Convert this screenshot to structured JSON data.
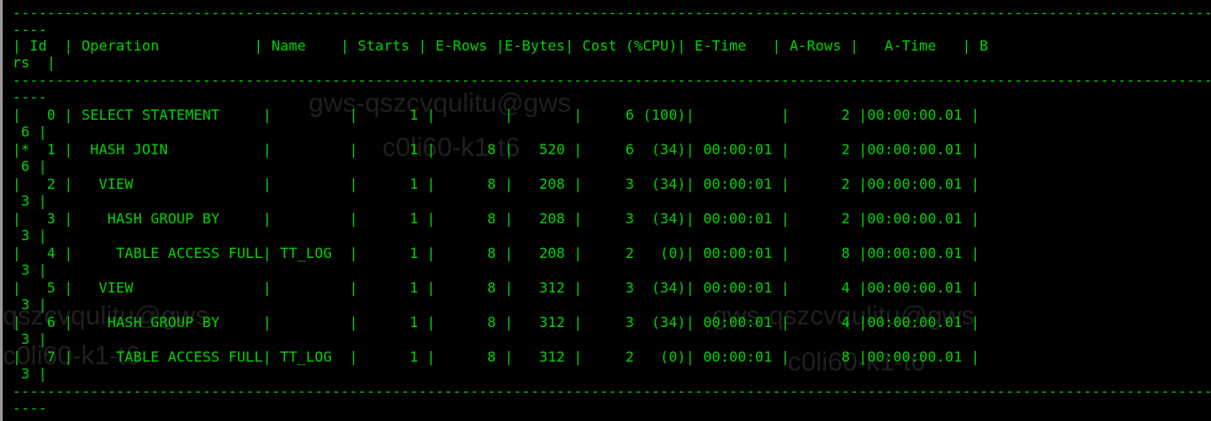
{
  "plan": {
    "separator": "----------------------------------------------------------------------------------------------------------------------------------------------------",
    "separator_tail": "----",
    "header_line1": "| Id  | Operation           | Name    | Starts | E-Rows |E-Bytes| Cost (%CPU)| E-Time   | A-Rows |   A-Time   | B",
    "header_line2": "rs  |",
    "rows": [
      {
        "line": "|   0 | SELECT STATEMENT     |         |      1 |        |       |     6 (100)|          |      2 |00:00:00.01 |",
        "tail": " 6 |"
      },
      {
        "line": "|*  1 |  HASH JOIN           |         |      1 |      8 |   520 |     6  (34)| 00:00:01 |      2 |00:00:00.01 |",
        "tail": " 6 |"
      },
      {
        "line": "|   2 |   VIEW               |         |      1 |      8 |   208 |     3  (34)| 00:00:01 |      2 |00:00:00.01 |",
        "tail": " 3 |"
      },
      {
        "line": "|   3 |    HASH GROUP BY     |         |      1 |      8 |   208 |     3  (34)| 00:00:01 |      2 |00:00:00.01 |",
        "tail": " 3 |"
      },
      {
        "line": "|   4 |     TABLE ACCESS FULL| TT_LOG  |      1 |      8 |   208 |     2   (0)| 00:00:01 |      8 |00:00:00.01 |",
        "tail": " 3 |"
      },
      {
        "line": "|   5 |   VIEW               |         |      1 |      8 |   312 |     3  (34)| 00:00:01 |      4 |00:00:00.01 |",
        "tail": " 3 |"
      },
      {
        "line": "|   6 |    HASH GROUP BY     |         |      1 |      8 |   312 |     3  (34)| 00:00:01 |      4 |00:00:00.01 |",
        "tail": " 3 |"
      },
      {
        "line": "|   7 |     TABLE ACCESS FULL| TT_LOG  |      1 |      8 |   312 |     2   (0)| 00:00:01 |      8 |00:00:00.01 |",
        "tail": " 3 |"
      }
    ]
  },
  "watermarks": {
    "w1": "gws-qszcvqulitu@gws",
    "w2": "c0li60-k1-t6",
    "w3": "gws-qszcvqulitu@gws",
    "w4": "qszcvqulitu@gws",
    "w5": "c0li60-k1-t6",
    "w6": "c0li60-k1-t6"
  }
}
